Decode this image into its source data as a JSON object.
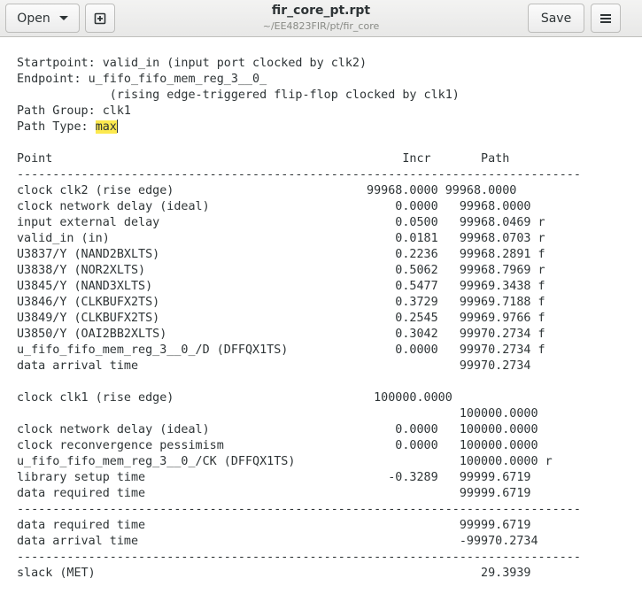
{
  "header": {
    "open_label": "Open",
    "save_label": "Save",
    "title": "fir_core_pt.rpt",
    "subtitle": "~/EE4823FIR/pt/fir_core"
  },
  "report": {
    "lines_before": "Startpoint: valid_in (input port clocked by clk2)\nEndpoint: u_fifo_fifo_mem_reg_3__0_\n             (rising edge-triggered flip-flop clocked by clk1)\nPath Group: clk1\nPath Type: ",
    "highlight": "max",
    "lines_after": "\n\nPoint                                                 Incr       Path\n-------------------------------------------------------------------------------\nclock clk2 (rise edge)                           99968.0000 99968.0000\nclock network delay (ideal)                          0.0000   99968.0000\ninput external delay                                 0.0500   99968.0469 r\nvalid_in (in)                                        0.0181   99968.0703 r\nU3837/Y (NAND2BXLTS)                                 0.2236   99968.2891 f\nU3838/Y (NOR2XLTS)                                   0.5062   99968.7969 r\nU3845/Y (NAND3XLTS)                                  0.5477   99969.3438 f\nU3846/Y (CLKBUFX2TS)                                 0.3729   99969.7188 f\nU3849/Y (CLKBUFX2TS)                                 0.2545   99969.9766 f\nU3850/Y (OAI2BB2XLTS)                                0.3042   99970.2734 f\nu_fifo_fifo_mem_reg_3__0_/D (DFFQX1TS)               0.0000   99970.2734 f\ndata arrival time                                             99970.2734\n\nclock clk1 (rise edge)                            100000.0000\n                                                              100000.0000\nclock network delay (ideal)                          0.0000   100000.0000\nclock reconvergence pessimism                        0.0000   100000.0000\nu_fifo_fifo_mem_reg_3__0_/CK (DFFQX1TS)                       100000.0000 r\nlibrary setup time                                  -0.3289   99999.6719\ndata required time                                            99999.6719\n-------------------------------------------------------------------------------\ndata required time                                            99999.6719\ndata arrival time                                             -99970.2734\n-------------------------------------------------------------------------------\nslack (MET)                                                      29.3939"
  }
}
